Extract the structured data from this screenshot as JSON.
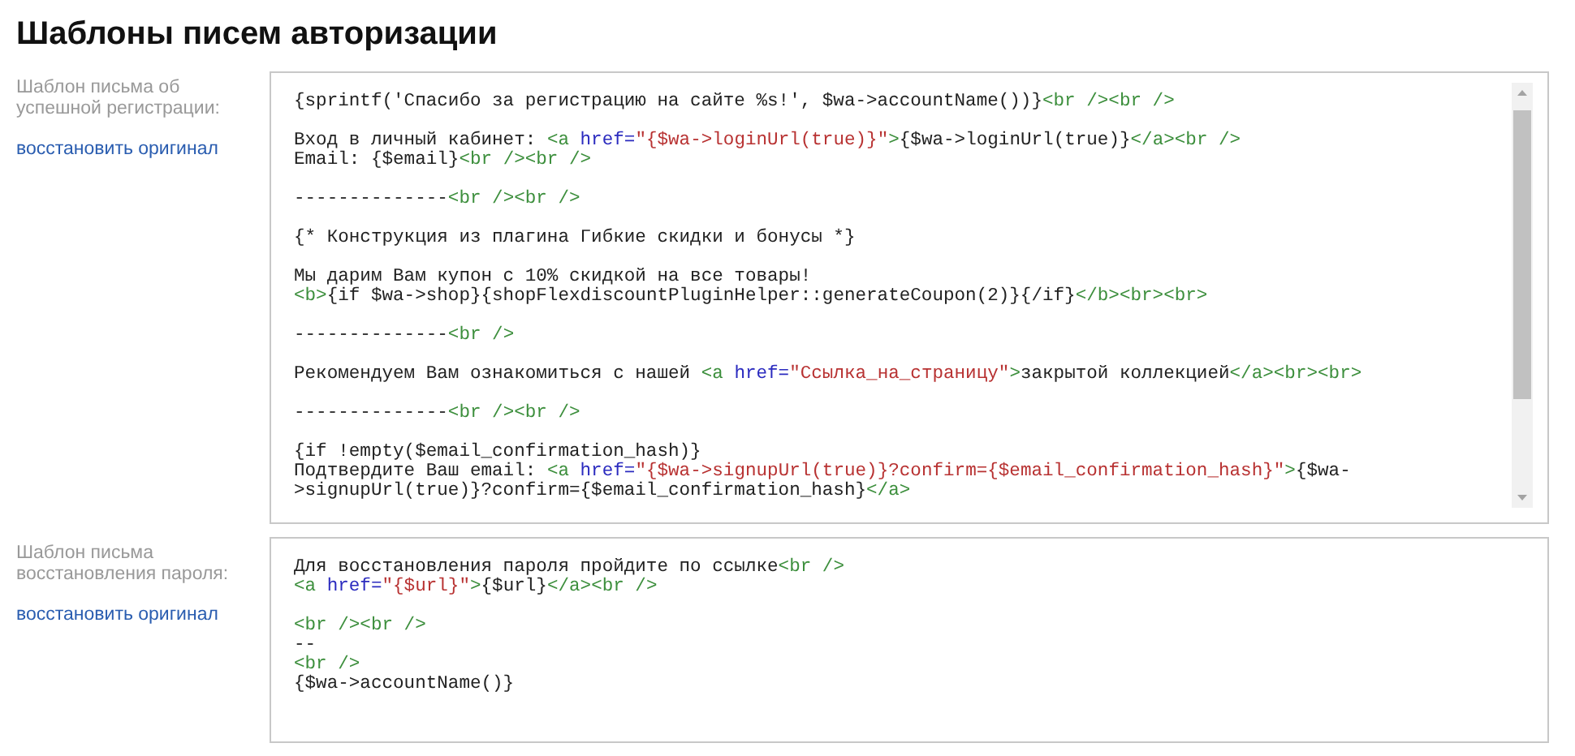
{
  "title": "Шаблоны писем авторизации",
  "templates": [
    {
      "label": "Шаблон письма об успешной регистрации:",
      "restore_link": "восстановить оригинал",
      "scrollbar": true,
      "lines": [
        {
          "gap": false,
          "tokens": [
            {
              "kind": "text",
              "text": "{sprintf('Спасибо за регистрацию на сайте %s!', $wa->accountName())}"
            },
            {
              "kind": "tag",
              "text": "<br /><br />"
            }
          ]
        },
        {
          "gap": true,
          "tokens": [
            {
              "kind": "text",
              "text": "Вход в личный кабинет: "
            },
            {
              "kind": "tag",
              "text": "<a "
            },
            {
              "kind": "attr",
              "text": "href="
            },
            {
              "kind": "value",
              "text": "\"{$wa->loginUrl(true)}\""
            },
            {
              "kind": "tag",
              "text": ">"
            },
            {
              "kind": "text",
              "text": "{$wa->loginUrl(true)}"
            },
            {
              "kind": "tag",
              "text": "</a><br />"
            }
          ]
        },
        {
          "gap": false,
          "tokens": [
            {
              "kind": "text",
              "text": "Email: {$email}"
            },
            {
              "kind": "tag",
              "text": "<br /><br />"
            }
          ]
        },
        {
          "gap": true,
          "tokens": [
            {
              "kind": "text",
              "text": "--------------"
            },
            {
              "kind": "tag",
              "text": "<br /><br />"
            }
          ]
        },
        {
          "gap": true,
          "tokens": [
            {
              "kind": "text",
              "text": "{* Конструкция из плагина Гибкие скидки и бонусы *}"
            }
          ]
        },
        {
          "gap": true,
          "tokens": [
            {
              "kind": "text",
              "text": "Мы дарим Вам купон с 10% скидкой на все товары!"
            }
          ]
        },
        {
          "gap": false,
          "tokens": [
            {
              "kind": "tag",
              "text": "<b>"
            },
            {
              "kind": "text",
              "text": "{if $wa->shop}{shopFlexdiscountPluginHelper::generateCoupon(2)}{/if}"
            },
            {
              "kind": "tag",
              "text": "</b><br><br>"
            }
          ]
        },
        {
          "gap": true,
          "tokens": [
            {
              "kind": "text",
              "text": "--------------"
            },
            {
              "kind": "tag",
              "text": "<br />"
            }
          ]
        },
        {
          "gap": true,
          "tokens": [
            {
              "kind": "text",
              "text": "Рекомендуем Вам ознакомиться с нашей "
            },
            {
              "kind": "tag",
              "text": "<a "
            },
            {
              "kind": "attr",
              "text": "href="
            },
            {
              "kind": "value",
              "text": "\"Ссылка_на_страницу\""
            },
            {
              "kind": "tag",
              "text": ">"
            },
            {
              "kind": "text",
              "text": "закрытой коллекцией"
            },
            {
              "kind": "tag",
              "text": "</a><br><br>"
            }
          ]
        },
        {
          "gap": true,
          "tokens": [
            {
              "kind": "text",
              "text": "--------------"
            },
            {
              "kind": "tag",
              "text": "<br /><br />"
            }
          ]
        },
        {
          "gap": true,
          "tokens": [
            {
              "kind": "text",
              "text": "{if !empty($email_confirmation_hash)}"
            }
          ]
        },
        {
          "gap": false,
          "tokens": [
            {
              "kind": "text",
              "text": "Подтвердите Ваш email: "
            },
            {
              "kind": "tag",
              "text": "<a "
            },
            {
              "kind": "attr",
              "text": "href="
            },
            {
              "kind": "value",
              "text": "\"{$wa->signupUrl(true)}?confirm={$email_confirmation_hash}\""
            },
            {
              "kind": "tag",
              "text": ">"
            },
            {
              "kind": "text",
              "text": "{$wa-"
            }
          ]
        },
        {
          "gap": false,
          "tokens": [
            {
              "kind": "text",
              "text": ">signupUrl(true)}?confirm={$email_confirmation_hash}"
            },
            {
              "kind": "tag",
              "text": "</a>"
            }
          ]
        }
      ]
    },
    {
      "label": "Шаблон письма восстановления пароля:",
      "restore_link": "восстановить оригинал",
      "scrollbar": false,
      "lines": [
        {
          "gap": false,
          "tokens": [
            {
              "kind": "text",
              "text": "Для восстановления пароля пройдите по ссылке"
            },
            {
              "kind": "tag",
              "text": "<br />"
            }
          ]
        },
        {
          "gap": false,
          "tokens": [
            {
              "kind": "tag",
              "text": "<a "
            },
            {
              "kind": "attr",
              "text": "href="
            },
            {
              "kind": "value",
              "text": "\"{$url}\""
            },
            {
              "kind": "tag",
              "text": ">"
            },
            {
              "kind": "text",
              "text": "{$url}"
            },
            {
              "kind": "tag",
              "text": "</a><br />"
            }
          ]
        },
        {
          "gap": true,
          "tokens": [
            {
              "kind": "tag",
              "text": "<br /><br />"
            }
          ]
        },
        {
          "gap": false,
          "tokens": [
            {
              "kind": "text",
              "text": "--"
            }
          ]
        },
        {
          "gap": false,
          "tokens": [
            {
              "kind": "tag",
              "text": "<br />"
            }
          ]
        },
        {
          "gap": false,
          "tokens": [
            {
              "kind": "text",
              "text": "{$wa->accountName()}"
            }
          ]
        }
      ]
    }
  ]
}
